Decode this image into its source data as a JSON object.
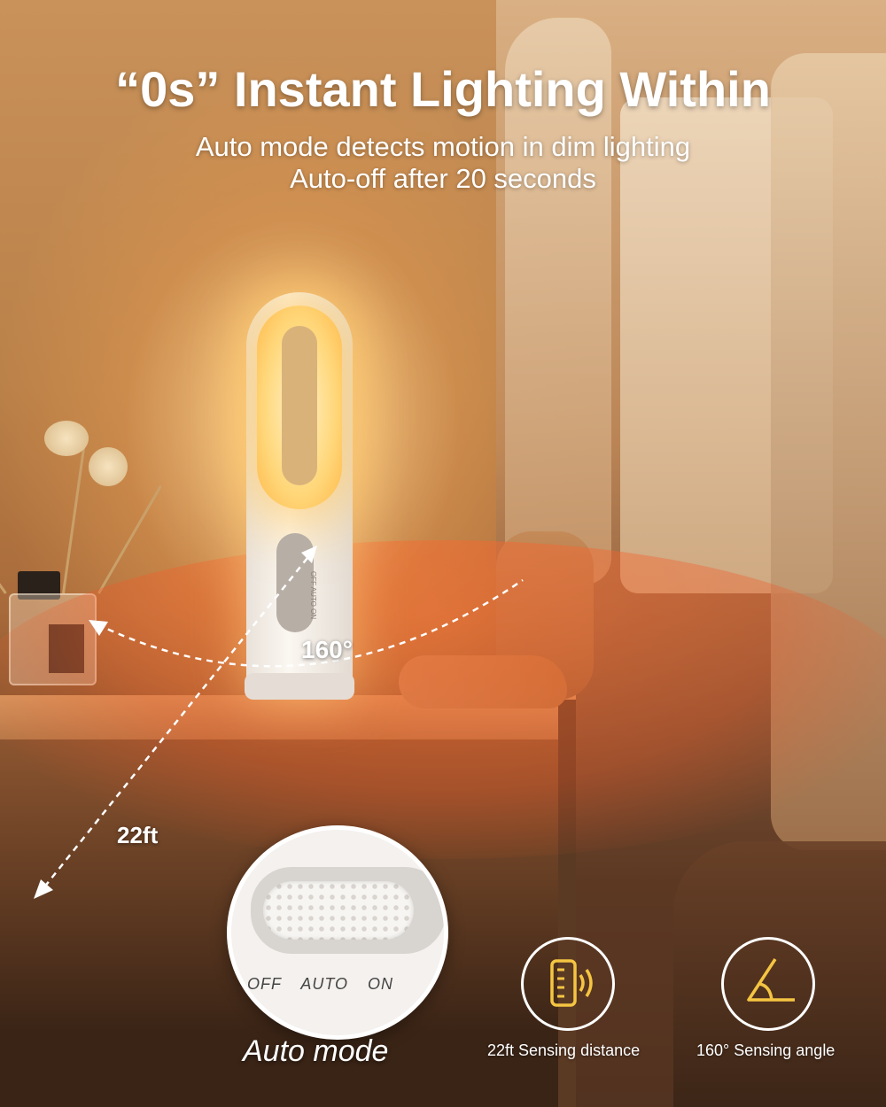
{
  "header": {
    "title": "“0s” Instant Lighting Within",
    "subtitle_line1": "Auto mode detects motion in dim lighting",
    "subtitle_line2": "Auto-off after 20 seconds"
  },
  "lamp": {
    "switch_labels": [
      "OFF",
      "AUTO",
      "ON"
    ]
  },
  "annotations": {
    "angle": "160°",
    "distance": "22ft"
  },
  "zoom": {
    "switch_labels": [
      "OFF",
      "AUTO",
      "ON"
    ],
    "caption": "Auto mode"
  },
  "features": [
    {
      "icon": "phone-sensing-icon",
      "caption": "22ft Sensing distance"
    },
    {
      "icon": "angle-icon",
      "caption": "160° Sensing angle"
    }
  ],
  "colors": {
    "accent": "#f5c542",
    "text": "#ffffff"
  }
}
